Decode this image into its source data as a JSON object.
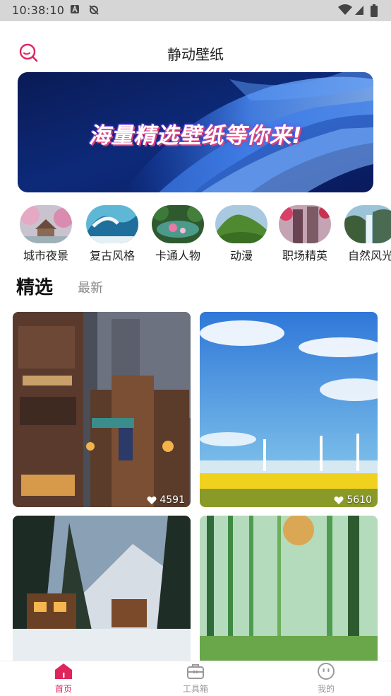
{
  "status_bar": {
    "time": "10:38:10"
  },
  "header": {
    "title": "静动壁纸"
  },
  "banner": {
    "text": "海量精选壁纸等你来!"
  },
  "categories": [
    {
      "label": "城市夜景"
    },
    {
      "label": "复古风格"
    },
    {
      "label": "卡通人物"
    },
    {
      "label": "动漫"
    },
    {
      "label": "职场精英"
    },
    {
      "label": "自然风光"
    }
  ],
  "tabs": {
    "featured": "精选",
    "latest": "最新"
  },
  "wallpapers": [
    {
      "likes": "4591"
    },
    {
      "likes": "5610"
    },
    {
      "likes": ""
    },
    {
      "likes": ""
    }
  ],
  "bottom_nav": [
    {
      "label": "首页",
      "icon": "home-icon",
      "active": true
    },
    {
      "label": "工具箱",
      "icon": "toolbox-icon",
      "active": false
    },
    {
      "label": "我的",
      "icon": "profile-icon",
      "active": false
    }
  ],
  "colors": {
    "accent": "#e0245e",
    "inactive": "#999999"
  }
}
